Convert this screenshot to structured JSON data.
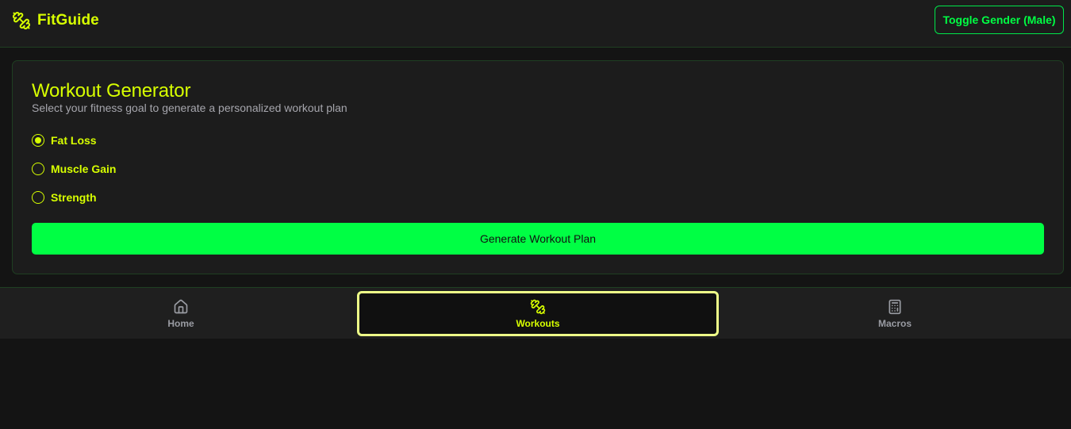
{
  "header": {
    "brand_name": "FitGuide",
    "brand_icon": "dumbbell-icon",
    "toggle_label": "Toggle Gender (Male)"
  },
  "generator": {
    "title": "Workout Generator",
    "subtitle": "Select your fitness goal to generate a personalized workout plan",
    "goals": [
      {
        "label": "Fat Loss",
        "checked": true
      },
      {
        "label": "Muscle Gain",
        "checked": false
      },
      {
        "label": "Strength",
        "checked": false
      }
    ],
    "generate_label": "Generate Workout Plan"
  },
  "nav": {
    "items": [
      {
        "label": "Home",
        "icon": "home-icon",
        "active": false
      },
      {
        "label": "Workouts",
        "icon": "dumbbell-icon",
        "active": true
      },
      {
        "label": "Macros",
        "icon": "calculator-icon",
        "active": false
      }
    ]
  },
  "colors": {
    "accent": "#d7ff00",
    "primary_green": "#00ff44",
    "background": "#141414",
    "surface": "#1c1c1c",
    "muted_text": "#a6a6ad",
    "active_border": "#eeff88"
  }
}
